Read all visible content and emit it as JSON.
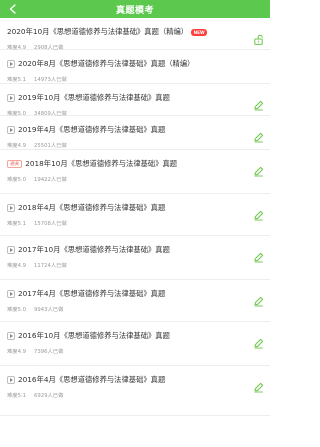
{
  "header": {
    "title": "真题模考",
    "back_icon": "back-arrow-icon"
  },
  "colors": {
    "header_bg": "#5cc84e",
    "accent": "#6cc64a",
    "new_badge": "#ff3d3d"
  },
  "items": [
    {
      "title": "2020年10月《思想道德修养与法律基础》真题（精编）",
      "difficulty": "难度4.9",
      "count": "2908人已做",
      "prefix": "none",
      "new_badge": "NEW",
      "action": "unlock"
    },
    {
      "title": "2020年8月《思想道德修养与法律基础》真题（精编）",
      "difficulty": "难度5.1",
      "count": "14973人已做",
      "prefix": "play",
      "new_badge": "",
      "action": "none"
    },
    {
      "title": "2019年10月《思想道德修养与法律基础》真题",
      "difficulty": "难度5.0",
      "count": "34809人已做",
      "prefix": "play",
      "new_badge": "",
      "action": "edit"
    },
    {
      "title": "2019年4月《思想道德修养与法律基础》真题",
      "difficulty": "难度4.9",
      "count": "25501人已做",
      "prefix": "play",
      "new_badge": "",
      "action": "edit"
    },
    {
      "title": "2018年10月《思想道德修养与法律基础》真题",
      "difficulty": "难度5.0",
      "count": "19422人已做",
      "prefix": "badge",
      "prefix_text": "通关",
      "new_badge": "",
      "action": "edit"
    },
    {
      "title": "2018年4月《思想道德修养与法律基础》真题",
      "difficulty": "难度5.1",
      "count": "15708人已做",
      "prefix": "play",
      "new_badge": "",
      "action": "edit"
    },
    {
      "title": "2017年10月《思想道德修养与法律基础》真题",
      "difficulty": "难度4.9",
      "count": "11724人已做",
      "prefix": "play",
      "new_badge": "",
      "action": "edit"
    },
    {
      "title": "2017年4月《思想道德修养与法律基础》真题",
      "difficulty": "难度5.0",
      "count": "9943人已做",
      "prefix": "play",
      "new_badge": "",
      "action": "edit"
    },
    {
      "title": "2016年10月《思想道德修养与法律基础》真题",
      "difficulty": "难度4.9",
      "count": "7396人已做",
      "prefix": "play",
      "new_badge": "",
      "action": "edit"
    },
    {
      "title": "2016年4月《思想道德修养与法律基础》真题",
      "difficulty": "难度5.1",
      "count": "6929人已做",
      "prefix": "play",
      "new_badge": "",
      "action": "edit"
    }
  ]
}
